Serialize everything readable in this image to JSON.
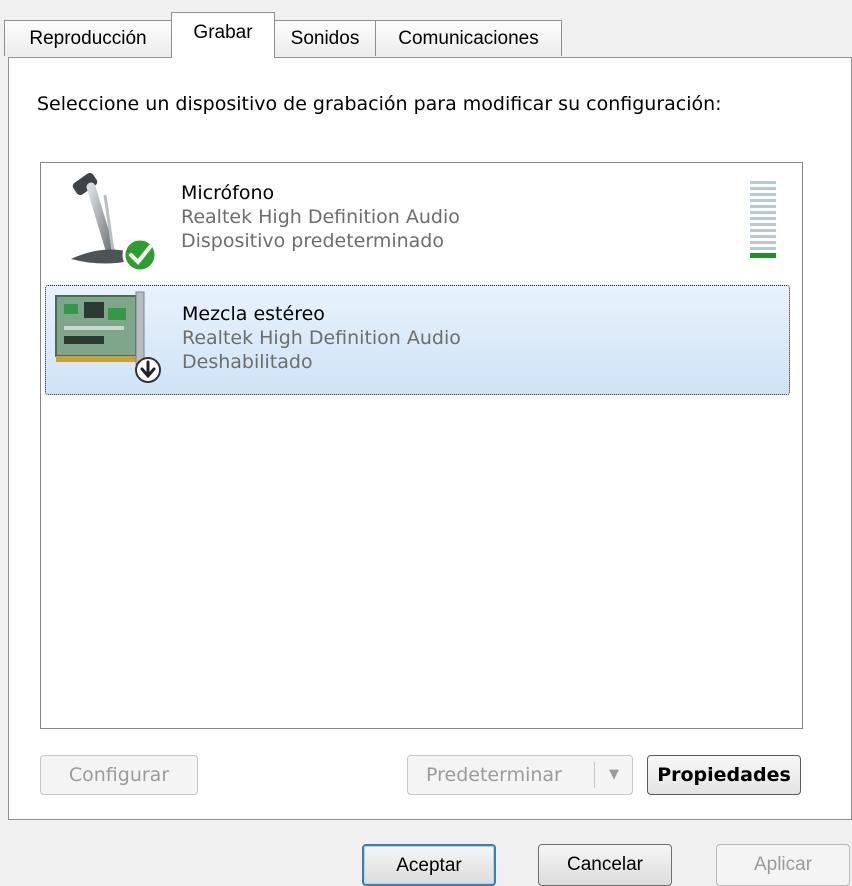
{
  "tabs": [
    {
      "label": "Reproducción"
    },
    {
      "label": "Grabar"
    },
    {
      "label": "Sonidos"
    },
    {
      "label": "Comunicaciones"
    }
  ],
  "active_tab": "Grabar",
  "instruction": "Seleccione un dispositivo de grabación para modificar su configuración:",
  "devices": [
    {
      "name": "Micrófono",
      "driver": "Realtek High Definition Audio",
      "status": "Dispositivo predeterminado",
      "icon": "microphone-icon",
      "badge": "checkmark-icon",
      "level_fraction": 0.1
    },
    {
      "name": "Mezcla estéreo",
      "driver": "Realtek High Definition Audio",
      "status": "Deshabilitado",
      "icon": "sound-card-icon",
      "badge": "disabled-arrow-icon",
      "selected": true
    }
  ],
  "buttons": {
    "configure": "Configurar",
    "set_default": "Predeterminar",
    "properties": "Propiedades",
    "ok": "Aceptar",
    "cancel": "Cancelar",
    "apply": "Aplicar"
  },
  "colors": {
    "selection": "#cfe3f7",
    "meter_active": "#1f8f2a",
    "meter_idle": "#b7c9d4",
    "check_badge": "#2f9e2f"
  }
}
